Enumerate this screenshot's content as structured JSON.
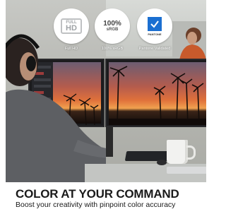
{
  "badges": [
    {
      "icon": "full-hd-icon",
      "icon_line1": "FULL",
      "icon_line2": "HD",
      "label": "Full HD"
    },
    {
      "icon": "srgb-icon",
      "icon_line1": "100%",
      "icon_line2": "sRGB",
      "label": "100% sRGB"
    },
    {
      "icon": "pantone-check-icon",
      "icon_word": "PANTONE",
      "label": "Pantone Validated"
    }
  ],
  "headline": "COLOR AT YOUR COMMAND",
  "subheadline": "Boost your creativity with pinpoint color accuracy",
  "colors": {
    "pantone_blue": "#1b6fd1",
    "sunset_orange": "#e0713b"
  }
}
